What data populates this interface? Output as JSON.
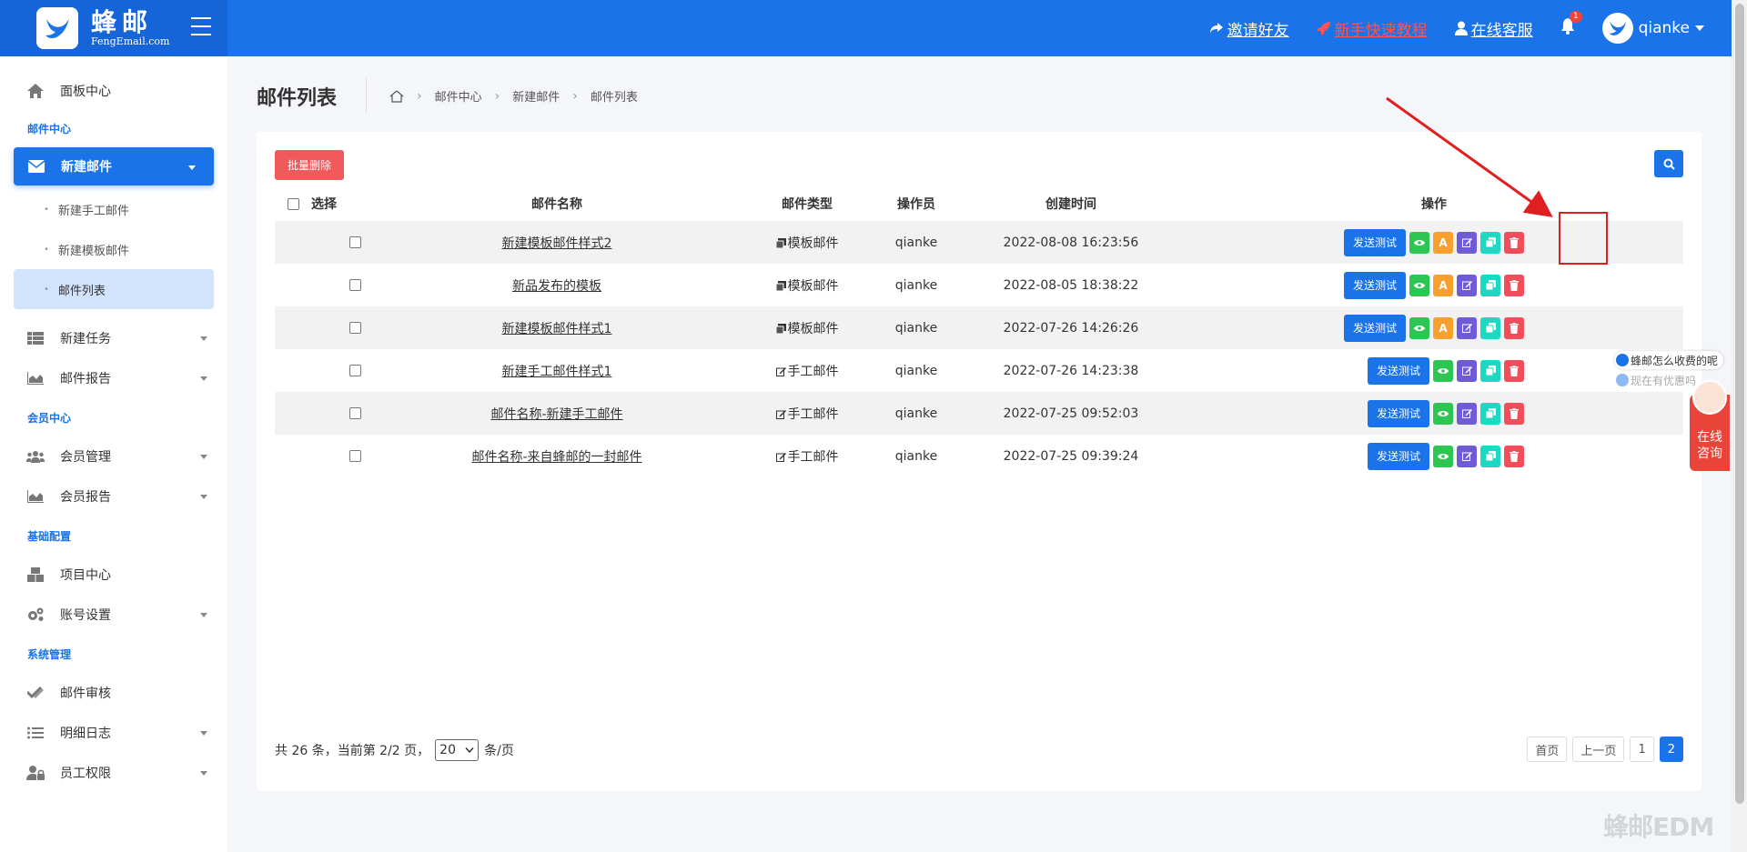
{
  "header": {
    "logo_cn": "蜂邮",
    "logo_en": "FengEmail.com",
    "links": {
      "invite": "邀请好友",
      "tutorial": "新手快速教程",
      "support": "在线客服"
    },
    "notification_count": "1",
    "username": "qianke"
  },
  "sidebar": {
    "dashboard": "面板中心",
    "section_mail": "邮件中心",
    "new_mail": "新建邮件",
    "new_manual_mail": "新建手工邮件",
    "new_template_mail": "新建模板邮件",
    "mail_list": "邮件列表",
    "new_task": "新建任务",
    "mail_report": "邮件报告",
    "section_member": "会员中心",
    "member_manage": "会员管理",
    "member_report": "会员报告",
    "section_config": "基础配置",
    "project_center": "项目中心",
    "account_settings": "账号设置",
    "section_system": "系统管理",
    "mail_review": "邮件审核",
    "detail_log": "明细日志",
    "staff_permission": "员工权限"
  },
  "page": {
    "title": "邮件列表",
    "breadcrumb": [
      "邮件中心",
      "新建邮件",
      "邮件列表"
    ]
  },
  "toolbar": {
    "batch_delete": "批量删除"
  },
  "table": {
    "headers": {
      "select": "选择",
      "name": "邮件名称",
      "type": "邮件类型",
      "operator": "操作员",
      "created": "创建时间",
      "actions": "操作"
    },
    "rows": [
      {
        "name": "新建模板邮件样式2",
        "type": "模板邮件",
        "operator": "qianke",
        "created": "2022-08-08 16:23:56",
        "kind": "template"
      },
      {
        "name": "新品发布的模板",
        "type": "模板邮件",
        "operator": "qianke",
        "created": "2022-08-05 18:38:22",
        "kind": "template"
      },
      {
        "name": "新建模板邮件样式1",
        "type": "模板邮件",
        "operator": "qianke",
        "created": "2022-07-26 14:26:26",
        "kind": "template"
      },
      {
        "name": "新建手工邮件样式1",
        "type": "手工邮件",
        "operator": "qianke",
        "created": "2022-07-26 14:23:38",
        "kind": "manual"
      },
      {
        "name": "邮件名称-新建手工邮件",
        "type": "手工邮件",
        "operator": "qianke",
        "created": "2022-07-25 09:52:03",
        "kind": "manual"
      },
      {
        "name": "邮件名称-来自蜂邮的一封邮件",
        "type": "手工邮件",
        "operator": "qianke",
        "created": "2022-07-25 09:39:24",
        "kind": "manual"
      }
    ],
    "send_test_label": "发送测试",
    "font_icon_label": "A"
  },
  "footer": {
    "summary_prefix": "共 26 条，当前第 2/2 页，",
    "page_size": "20",
    "summary_suffix": "条/页",
    "pager": {
      "first": "首页",
      "prev": "上一页",
      "page1": "1",
      "page2": "2"
    }
  },
  "float": {
    "bubble1": "蜂邮怎么收费的呢",
    "bubble2": "现在有优惠吗",
    "consult": "在线咨询",
    "watermark": "蜂邮EDM"
  },
  "colors": {
    "primary": "#1a73e8",
    "danger": "#f15a5a",
    "success": "#2dc653",
    "warning": "#f7a030",
    "purple": "#6f5bd6",
    "teal": "#1ed8c4"
  }
}
